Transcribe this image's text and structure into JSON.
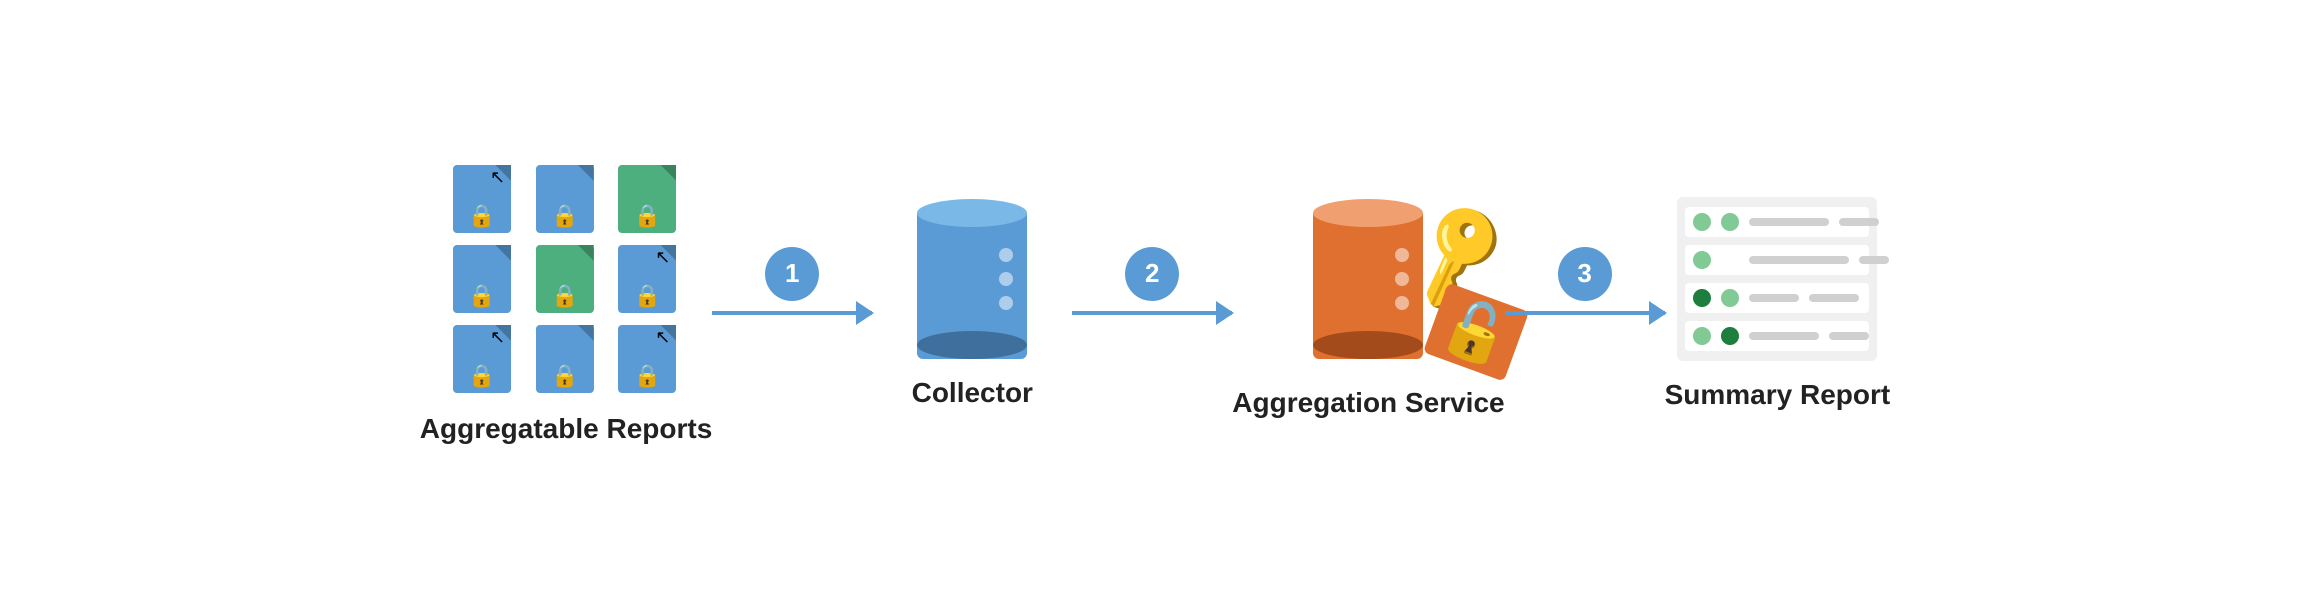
{
  "diagram": {
    "nodes": [
      {
        "id": "aggregatable-reports",
        "label": "Aggregatable\nReports",
        "type": "reports-grid"
      },
      {
        "id": "collector",
        "label": "Collector",
        "type": "cylinder-blue"
      },
      {
        "id": "aggregation-service",
        "label": "Aggregation\nService",
        "type": "cylinder-orange"
      },
      {
        "id": "summary-report",
        "label": "Summary\nReport",
        "type": "summary"
      }
    ],
    "arrows": [
      {
        "step": "1"
      },
      {
        "step": "2"
      },
      {
        "step": "3"
      }
    ],
    "labels": {
      "aggregatable_reports": "Aggregatable\nReports",
      "collector": "Collector",
      "aggregation_service": "Aggregation\nService",
      "summary_report": "Summary\nReport"
    },
    "colors": {
      "blue_accent": "#5b9bd5",
      "orange_accent": "#e07030",
      "green_light": "#81c995",
      "green_dark": "#1e7e3e",
      "file_blue": "#5b9bd5",
      "file_green": "#4caf7d"
    }
  }
}
